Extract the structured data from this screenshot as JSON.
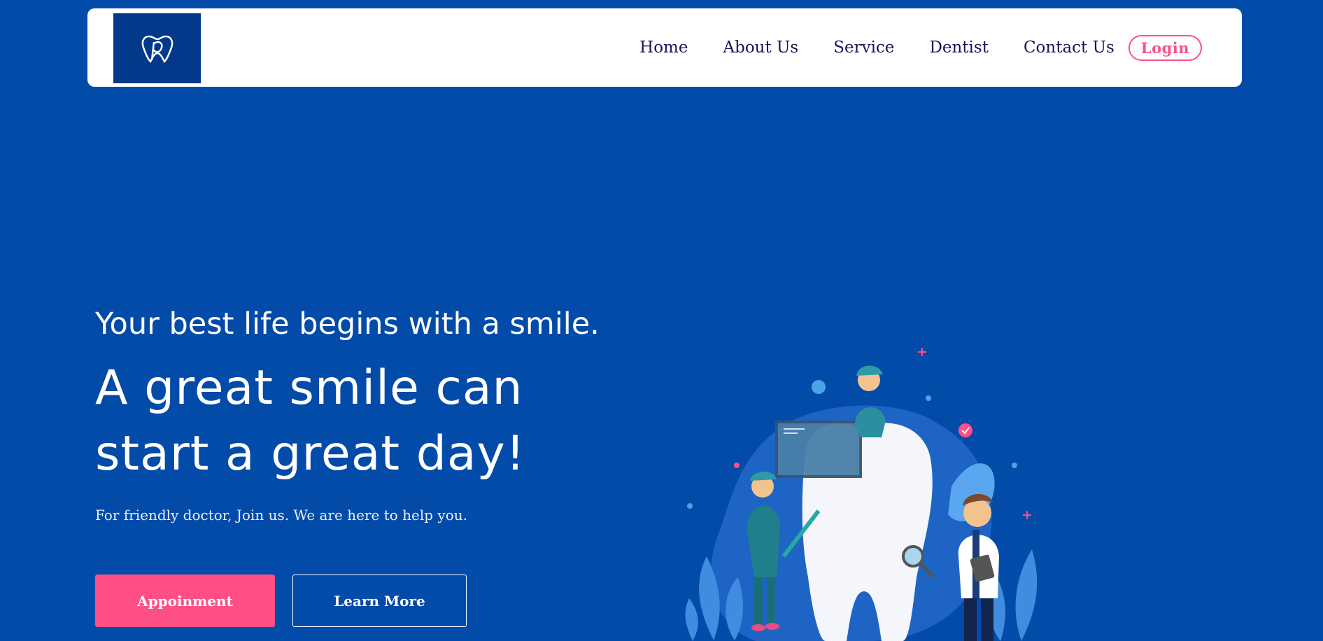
{
  "header": {
    "logo_alt": "dental tooth logo",
    "nav": [
      "Home",
      "About Us",
      "Service",
      "Dentist",
      "Contact Us"
    ],
    "login_label": "Login"
  },
  "hero": {
    "subtitle": "Your best life begins with a smile.",
    "title_line1": "A great smile can",
    "title_line2": "start a great day!",
    "description": "For friendly doctor, Join us. We are here to help you.",
    "primary_button": "Appoinment",
    "secondary_button": "Learn More"
  },
  "colors": {
    "background": "#034ba9",
    "navbar": "#ffffff",
    "nav_text": "#16155c",
    "accent_pink": "#ff4f85",
    "logo_bg": "#03388a"
  },
  "icons": {
    "logo": "tooth-logo-icon",
    "illustration": "dentists-with-giant-tooth-illustration"
  }
}
